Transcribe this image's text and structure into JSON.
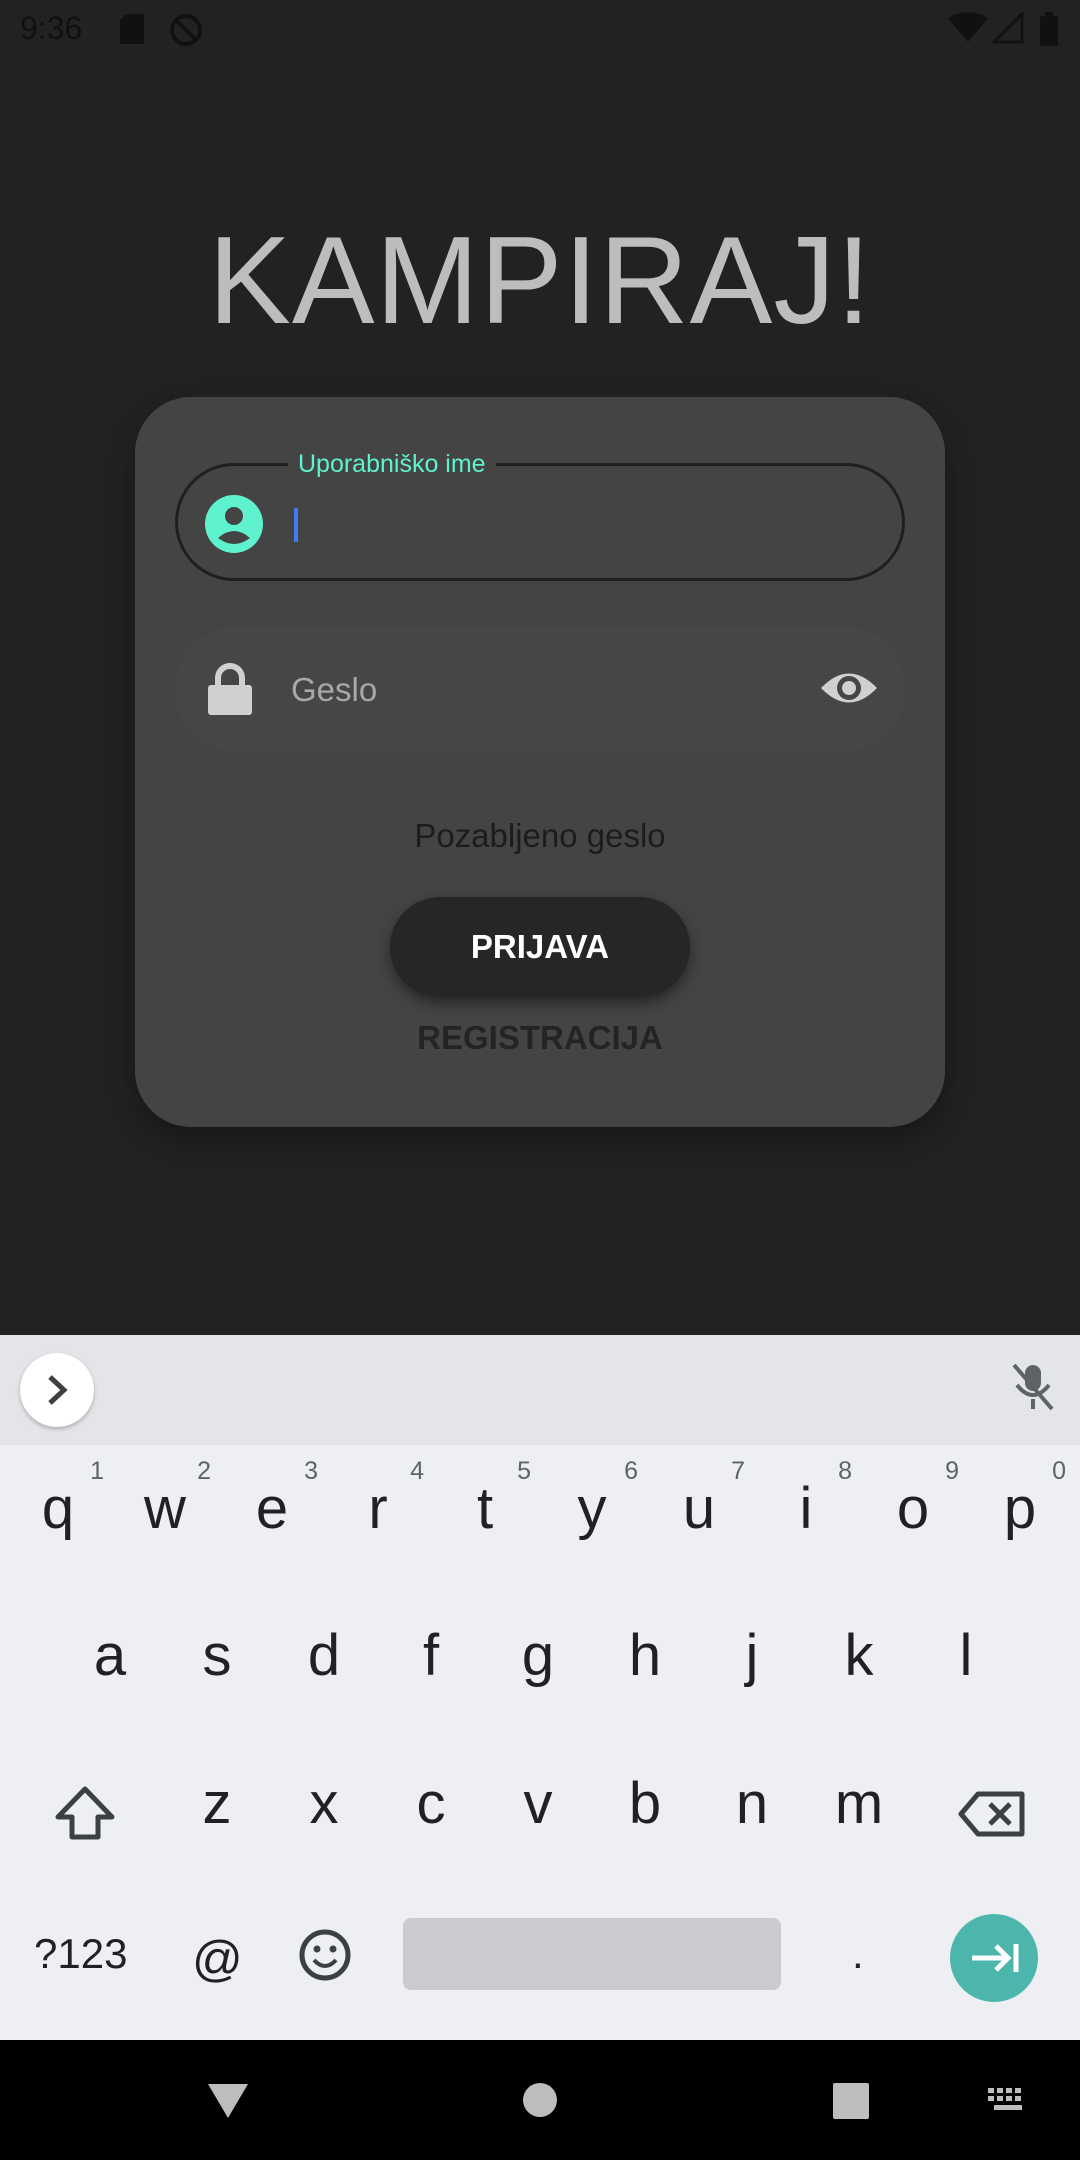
{
  "status_bar": {
    "time": "9:36"
  },
  "app": {
    "title": "KAMPIRAJ!"
  },
  "login": {
    "username_label": "Uporabniško ime",
    "password_placeholder": "Geslo",
    "forgot_password": "Pozabljeno geslo",
    "login_button": "PRIJAVA",
    "register_link": "REGISTRACIJA"
  },
  "keyboard": {
    "row1": [
      {
        "ch": "q",
        "hint": "1"
      },
      {
        "ch": "w",
        "hint": "2"
      },
      {
        "ch": "e",
        "hint": "3"
      },
      {
        "ch": "r",
        "hint": "4"
      },
      {
        "ch": "t",
        "hint": "5"
      },
      {
        "ch": "y",
        "hint": "6"
      },
      {
        "ch": "u",
        "hint": "7"
      },
      {
        "ch": "i",
        "hint": "8"
      },
      {
        "ch": "o",
        "hint": "9"
      },
      {
        "ch": "p",
        "hint": "0"
      }
    ],
    "row2": [
      "a",
      "s",
      "d",
      "f",
      "g",
      "h",
      "j",
      "k",
      "l"
    ],
    "row3": [
      "z",
      "x",
      "c",
      "v",
      "b",
      "n",
      "m"
    ],
    "symbols_key": "?123",
    "at_key": "@",
    "period_key": "."
  },
  "colors": {
    "accent": "#5ff2cf",
    "enter_key": "#4db6ac",
    "background": "#222222",
    "card": "#444444"
  },
  "icons": {
    "username": "account-circle-icon",
    "password": "lock-icon",
    "visibility": "eye-icon",
    "keyboard_expand": "chevron-right-icon",
    "mic_off": "mic-off-icon"
  }
}
